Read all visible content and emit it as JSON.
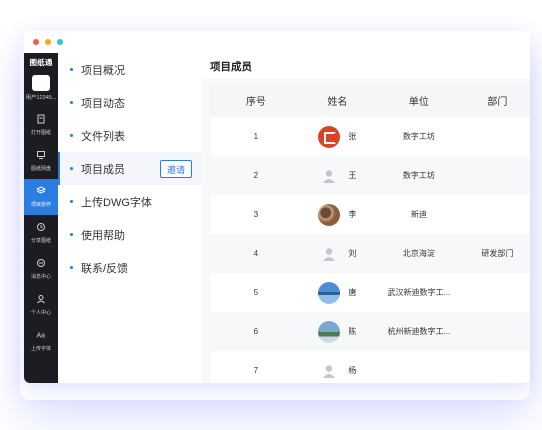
{
  "app": {
    "brand": "图纸通",
    "user": "用户12345..."
  },
  "nav": [
    {
      "label": "打开图纸",
      "icon": "open-drawing-icon"
    },
    {
      "label": "图纸网盘",
      "icon": "cloud-drive-icon"
    },
    {
      "label": "项目协作",
      "icon": "project-collab-icon",
      "active": true
    },
    {
      "label": "分享图纸",
      "icon": "share-icon"
    },
    {
      "label": "消息中心",
      "icon": "message-icon"
    },
    {
      "label": "个人中心",
      "icon": "person-icon"
    },
    {
      "label": "上传字体",
      "icon": "font-icon"
    }
  ],
  "menu": [
    {
      "label": "项目概况"
    },
    {
      "label": "项目动态"
    },
    {
      "label": "文件列表"
    },
    {
      "label": "项目成员",
      "active": true
    },
    {
      "label": "上传DWG字体"
    },
    {
      "label": "使用帮助"
    },
    {
      "label": "联系/反馈"
    }
  ],
  "invite_label": "邀请",
  "content": {
    "title": "项目成员",
    "columns": [
      "序号",
      "姓名",
      "单位",
      "部门"
    ],
    "rows": [
      {
        "no": "1",
        "name": "张",
        "unit": "数字工坊",
        "dept": "",
        "avatar": "red"
      },
      {
        "no": "2",
        "name": "王",
        "unit": "数字工坊",
        "dept": "",
        "avatar": "default"
      },
      {
        "no": "3",
        "name": "李",
        "unit": "新迪",
        "dept": "",
        "avatar": "photo1"
      },
      {
        "no": "4",
        "name": "刘",
        "unit": "北京海淀",
        "dept": "研发部门",
        "avatar": "default"
      },
      {
        "no": "5",
        "name": "唐",
        "unit": "武汉新迪数字工...",
        "dept": "",
        "avatar": "photo2"
      },
      {
        "no": "6",
        "name": "陈",
        "unit": "杭州新迪数字工...",
        "dept": "",
        "avatar": "photo3"
      },
      {
        "no": "7",
        "name": "杨",
        "unit": "",
        "dept": "",
        "avatar": "default"
      }
    ]
  },
  "colors": {
    "accent": "#2a7de1",
    "nav_bg": "#1c1d22"
  }
}
